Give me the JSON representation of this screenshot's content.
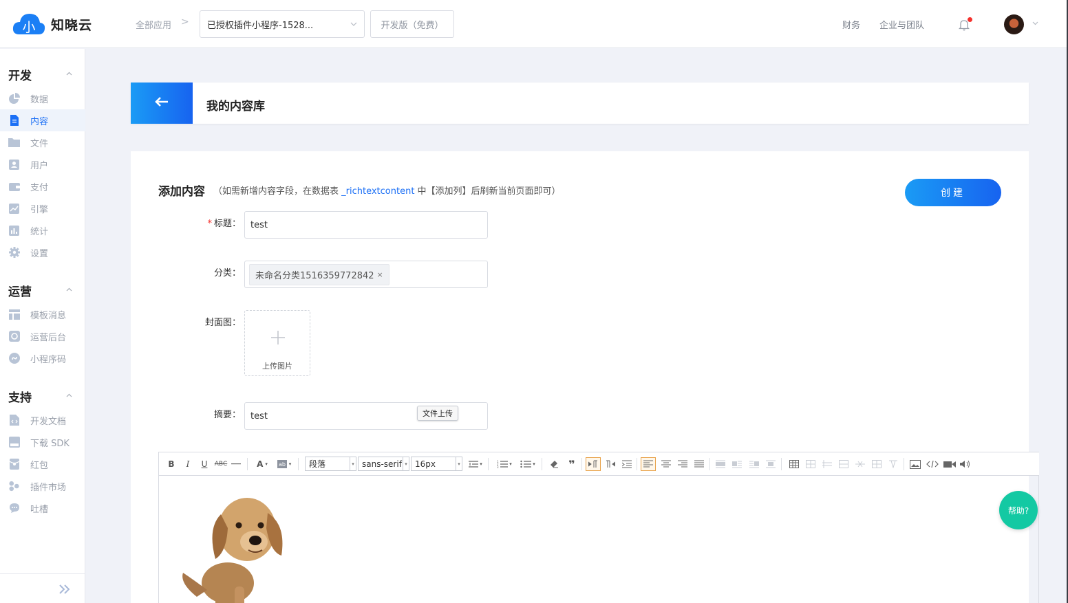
{
  "brand": {
    "name": "知晓云",
    "logo_glyph": "小"
  },
  "header": {
    "breadcrumb_all": "全部应用",
    "breadcrumb_sep": ">",
    "app_select": "已授权插件小程序-1528...",
    "version": "开发版（免费）",
    "nav_finance": "财务",
    "nav_team": "企业与团队"
  },
  "sidebar": {
    "sections": [
      {
        "title": "开发",
        "items": [
          "数据",
          "内容",
          "文件",
          "用户",
          "支付",
          "引擎",
          "统计",
          "设置"
        ]
      },
      {
        "title": "运营",
        "items": [
          "模板消息",
          "运营后台",
          "小程序码"
        ]
      },
      {
        "title": "支持",
        "items": [
          "开发文档",
          "下载 SDK",
          "红包",
          "插件市场",
          "吐槽"
        ]
      }
    ],
    "active_item": "内容"
  },
  "page": {
    "title": "我的内容库"
  },
  "form": {
    "heading": "添加内容",
    "note_prefix": "（如需新增内容字段，在数据表 ",
    "note_link": "_richtextcontent",
    "note_suffix": " 中【添加列】后刷新当前页面即可）",
    "create_label": "创建",
    "title_label": "标题：",
    "title_value": "test",
    "category_label": "分类：",
    "category_tag": "未命名分类1516359772842",
    "category_tag_close": "×",
    "cover_label": "封面图：",
    "upload_label": "上传图片",
    "summary_label": "摘要：",
    "summary_value": "test",
    "tooltip": "文件上传"
  },
  "editor": {
    "paragraph_select": "段落",
    "font_select": "sans-serif",
    "size_select": "16px"
  },
  "help": {
    "label": "帮助?"
  },
  "colors": {
    "primary": "#1b6ff5",
    "help": "#13c9a3",
    "required": "#f5312c"
  }
}
